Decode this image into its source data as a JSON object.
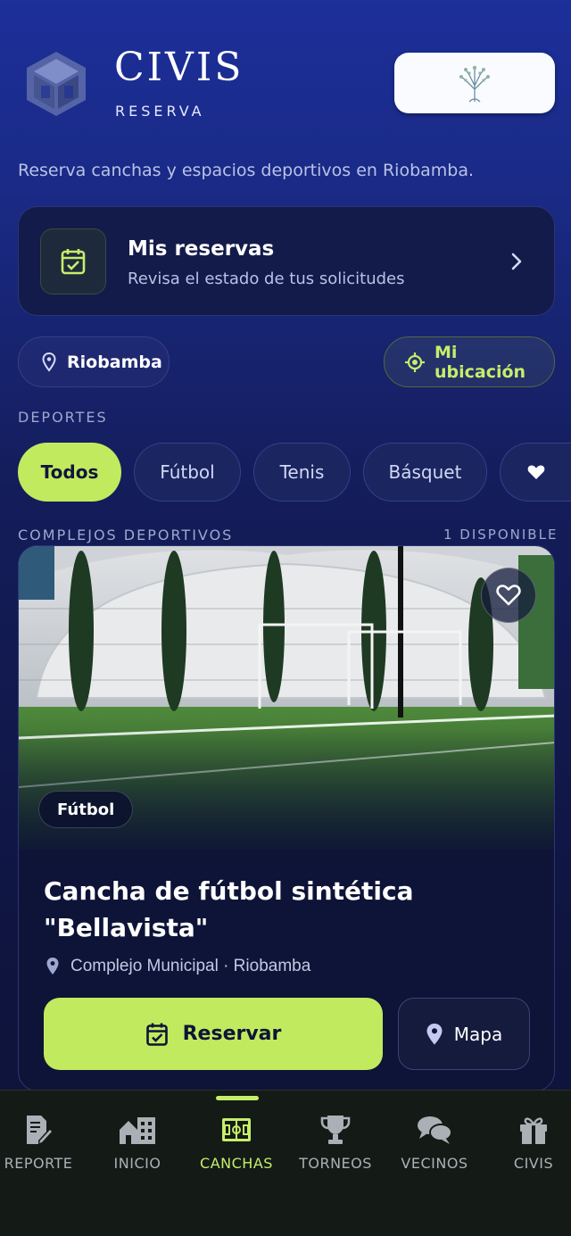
{
  "header": {
    "brand_title": "CIVIS",
    "brand_subtitle": "RESERVA",
    "tagline": "Reserva canchas y espacios deportivos en Riobamba."
  },
  "reservations_card": {
    "title": "Mis reservas",
    "subtitle": "Revisa el estado de tus solicitudes"
  },
  "location": {
    "city": "Riobamba",
    "my_location_label": "Mi ubicación"
  },
  "sports": {
    "section_label": "DEPORTES",
    "items": [
      {
        "label": "Todos",
        "active": true
      },
      {
        "label": "Fútbol",
        "active": false
      },
      {
        "label": "Tenis",
        "active": false
      },
      {
        "label": "Básquet",
        "active": false
      }
    ]
  },
  "complexes": {
    "section_label": "COMPLEJOS DEPORTIVOS",
    "count_label": "1 DISPONIBLE",
    "items": [
      {
        "tag": "Fútbol",
        "title": "Cancha de fútbol sintética \"Bellavista\"",
        "address": "Complejo Municipal · Riobamba",
        "reserve_label": "Reservar",
        "map_label": "Mapa"
      }
    ]
  },
  "bottom_nav": {
    "items": [
      {
        "label": "REPORTE",
        "icon": "report-icon",
        "active": false
      },
      {
        "label": "INICIO",
        "icon": "city-icon",
        "active": false
      },
      {
        "label": "CANCHAS",
        "icon": "field-icon",
        "active": true
      },
      {
        "label": "TORNEOS",
        "icon": "trophy-icon",
        "active": false
      },
      {
        "label": "VECINOS",
        "icon": "chat-icon",
        "active": false
      },
      {
        "label": "CIVIS",
        "icon": "gift-icon",
        "active": false
      }
    ]
  },
  "colors": {
    "accent": "#c2ea5e",
    "background_top": "#1c2f9a",
    "background_bottom": "#0d1236",
    "nav_background": "#141a16"
  }
}
